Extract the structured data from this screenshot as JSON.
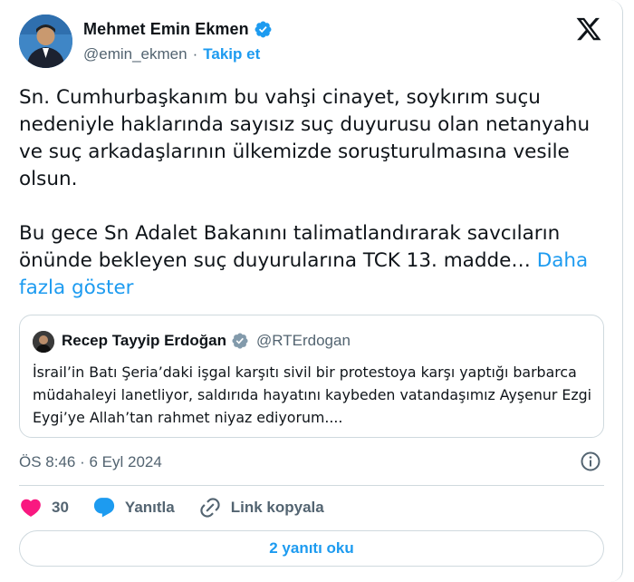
{
  "author": {
    "name": "Mehmet Emin Ekmen",
    "handle": "@emin_ekmen",
    "separator": "·",
    "follow_label": "Takip et"
  },
  "tweet": {
    "paragraph1": "Sn. Cumhurbaşkanım bu vahşi cinayet, soykırım suçu nedeniyle haklarında sayısız suç duyurusu olan netanyahu ve suç arkadaşlarının ülkemizde soruşturulmasına vesile olsun.",
    "paragraph2": "Bu gece Sn Adalet Bakanını talimatlandırarak savcıların önünde bekleyen suç duyurularına TCK 13. madde…",
    "show_more_label": "Daha fazla göster"
  },
  "quoted": {
    "name": "Recep Tayyip Erdoğan",
    "handle": "@RTErdogan",
    "text": "İsrail’in Batı Şeria’daki işgal karşıtı sivil bir protestoya karşı yaptığı barbarca müdahaleyi lanetliyor, saldırıda hayatını kaybeden vatandaşımız Ayşenur Ezgi Eygi’ye Allah’tan rahmet niyaz ediyorum...."
  },
  "meta": {
    "timestamp": "ÖS 8:46 · 6 Eyl 2024"
  },
  "actions": {
    "like_count": "30",
    "reply_label": "Yanıtla",
    "copy_link_label": "Link kopyala"
  },
  "replies_button_label": "2 yanıtı oku",
  "colors": {
    "accent": "#1d9bf0",
    "like": "#f91880",
    "text": "#0f1419",
    "muted": "#536471",
    "border": "#cfd9de"
  }
}
